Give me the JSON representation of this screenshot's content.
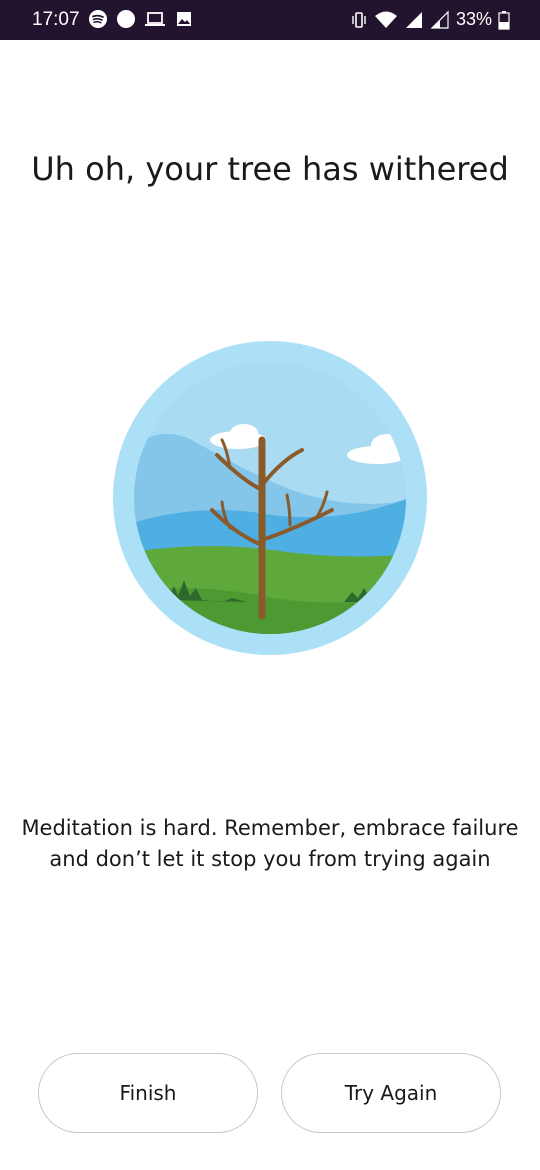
{
  "status_bar": {
    "time": "17:07",
    "battery_percent": "33%",
    "left_icons": [
      "spotify-icon",
      "circle-notification-icon",
      "laptop-icon",
      "image-icon"
    ],
    "right_icons": [
      "vibrate-icon",
      "wifi-icon",
      "signal-icon",
      "signal-weak-icon",
      "battery-icon"
    ]
  },
  "screen": {
    "title": "Uh oh, your tree has withered",
    "illustration": "withered-tree-icon",
    "message": "Meditation is hard. Remember, embrace failure and don’t let it stop you from trying again"
  },
  "buttons": {
    "finish_label": "Finish",
    "try_again_label": "Try Again"
  },
  "colors": {
    "status_bar_bg": "#22142e",
    "sky": "#a9dbf2",
    "mountain": "#5aafe0",
    "grass": "#5fa83c",
    "trunk": "#8b5a2b"
  }
}
